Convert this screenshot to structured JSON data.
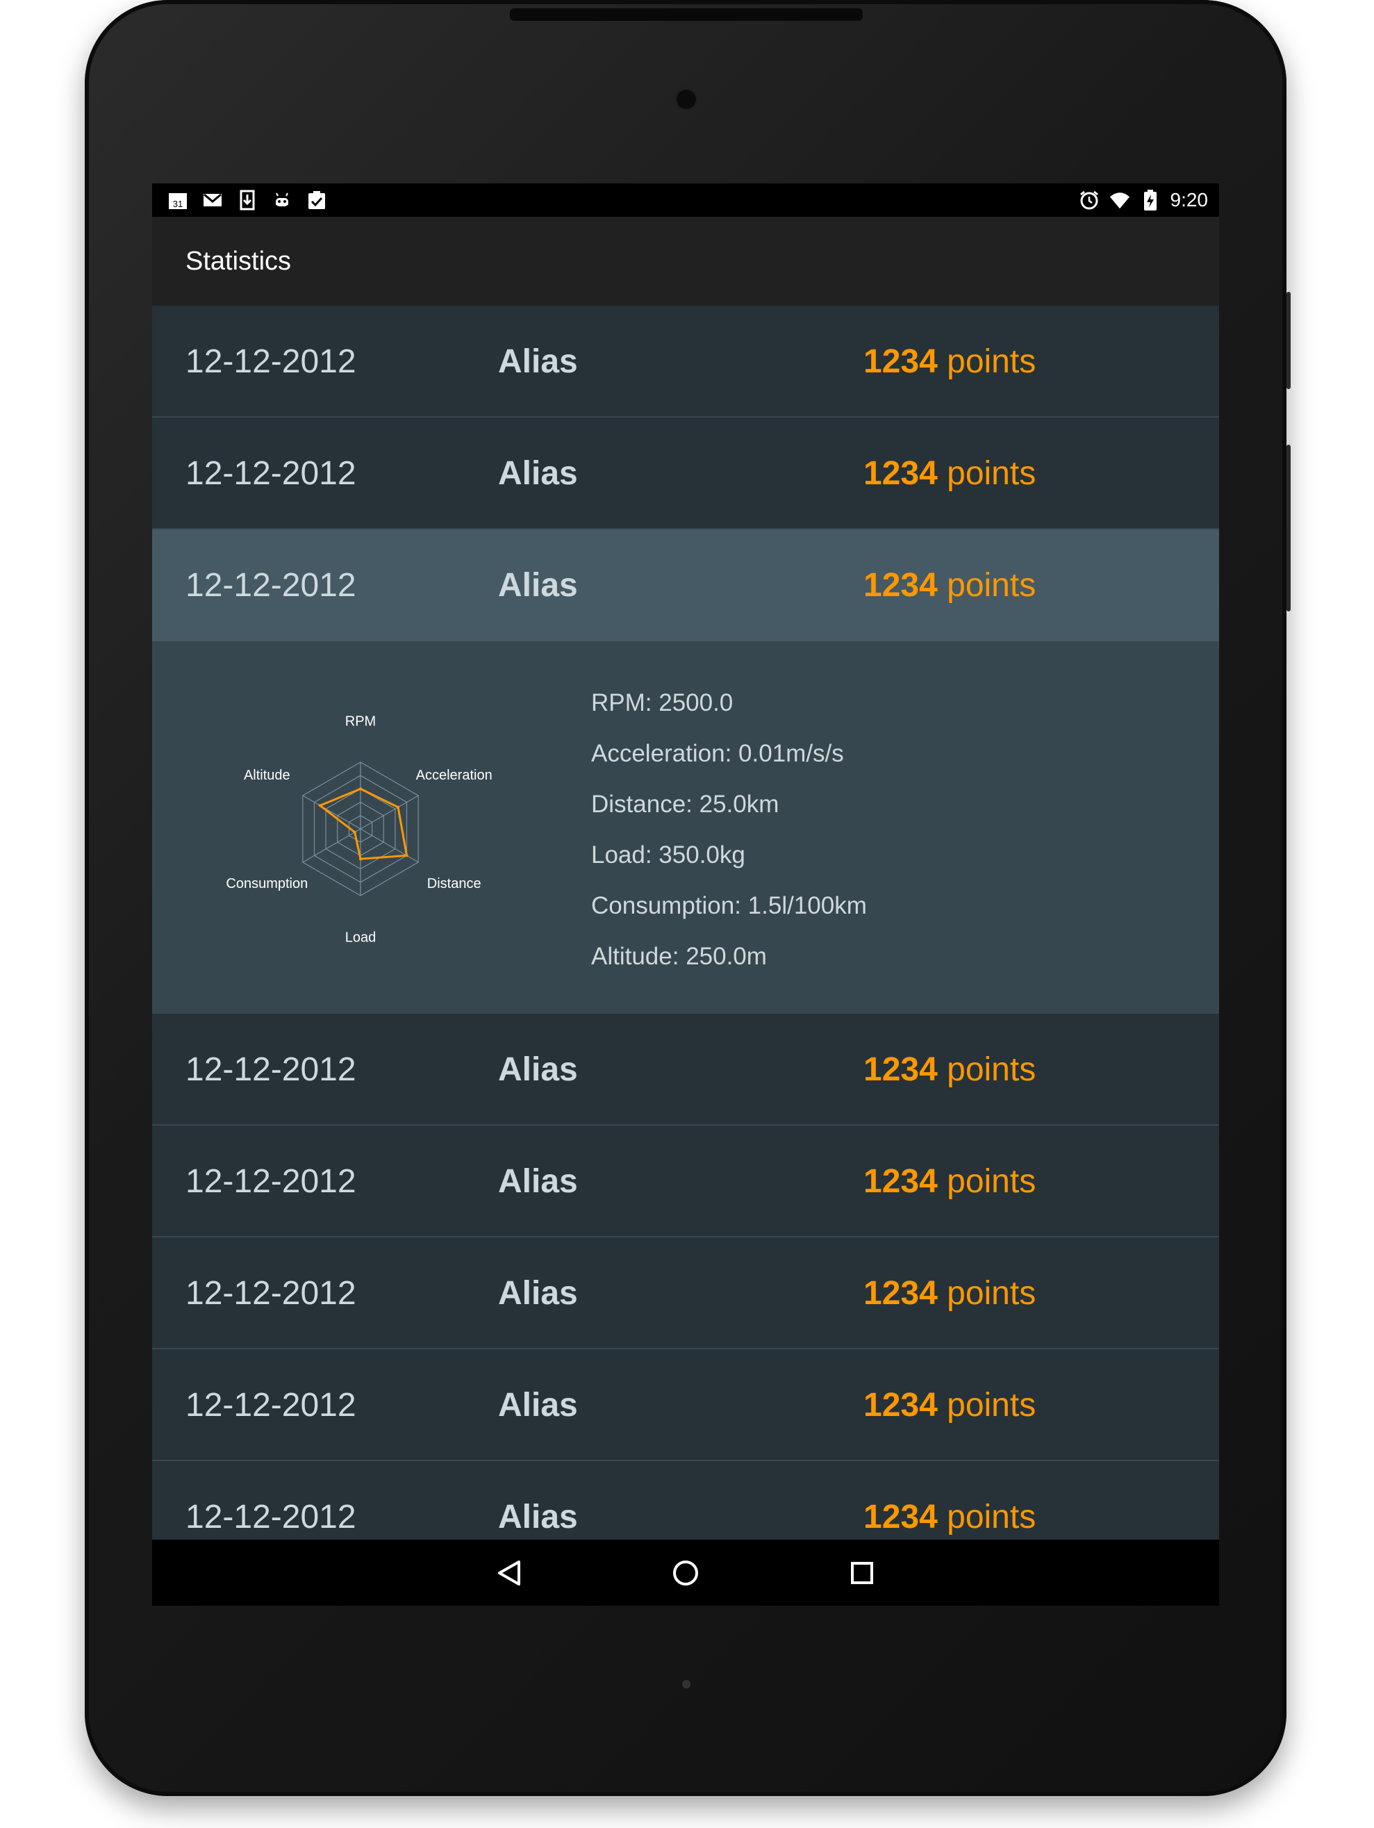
{
  "statusbar": {
    "left_icons": [
      "calendar-icon",
      "gmail-icon",
      "download-icon",
      "android-icon",
      "clipboard-check-icon"
    ],
    "calendar_day": "31",
    "right_icons": [
      "alarm-icon",
      "wifi-icon",
      "battery-charging-icon"
    ],
    "time": "9:20"
  },
  "toolbar": {
    "title": "Statistics"
  },
  "rows": [
    {
      "date": "12-12-2012",
      "alias": "Alias",
      "points": "1234",
      "points_unit": "points"
    },
    {
      "date": "12-12-2012",
      "alias": "Alias",
      "points": "1234",
      "points_unit": "points"
    },
    {
      "date": "12-12-2012",
      "alias": "Alias",
      "points": "1234",
      "points_unit": "points",
      "selected": true
    },
    {
      "date": "12-12-2012",
      "alias": "Alias",
      "points": "1234",
      "points_unit": "points"
    },
    {
      "date": "12-12-2012",
      "alias": "Alias",
      "points": "1234",
      "points_unit": "points"
    },
    {
      "date": "12-12-2012",
      "alias": "Alias",
      "points": "1234",
      "points_unit": "points"
    },
    {
      "date": "12-12-2012",
      "alias": "Alias",
      "points": "1234",
      "points_unit": "points"
    },
    {
      "date": "12-12-2012",
      "alias": "Alias",
      "points": "1234",
      "points_unit": "points"
    }
  ],
  "detail": {
    "radar": {
      "axes": [
        "RPM",
        "Acceleration",
        "Distance",
        "Load",
        "Consumption",
        "Altitude"
      ],
      "values": [
        0.6,
        0.65,
        0.8,
        0.45,
        0.1,
        0.7
      ],
      "levels": 5,
      "series_color": "#ff9800",
      "grid_color": "#78909c"
    },
    "stats": [
      "RPM: 2500.0",
      "Acceleration: 0.01m/s/s",
      "Distance: 25.0km",
      "Load: 350.0kg",
      "Consumption: 1.5l/100km",
      "Altitude: 250.0m"
    ]
  },
  "navbar": {
    "icons": [
      "back-icon",
      "home-icon",
      "recents-icon"
    ]
  },
  "colors": {
    "accent": "#ff9800",
    "background": "#263238",
    "selected": "#455a64",
    "detail": "#37474f"
  }
}
